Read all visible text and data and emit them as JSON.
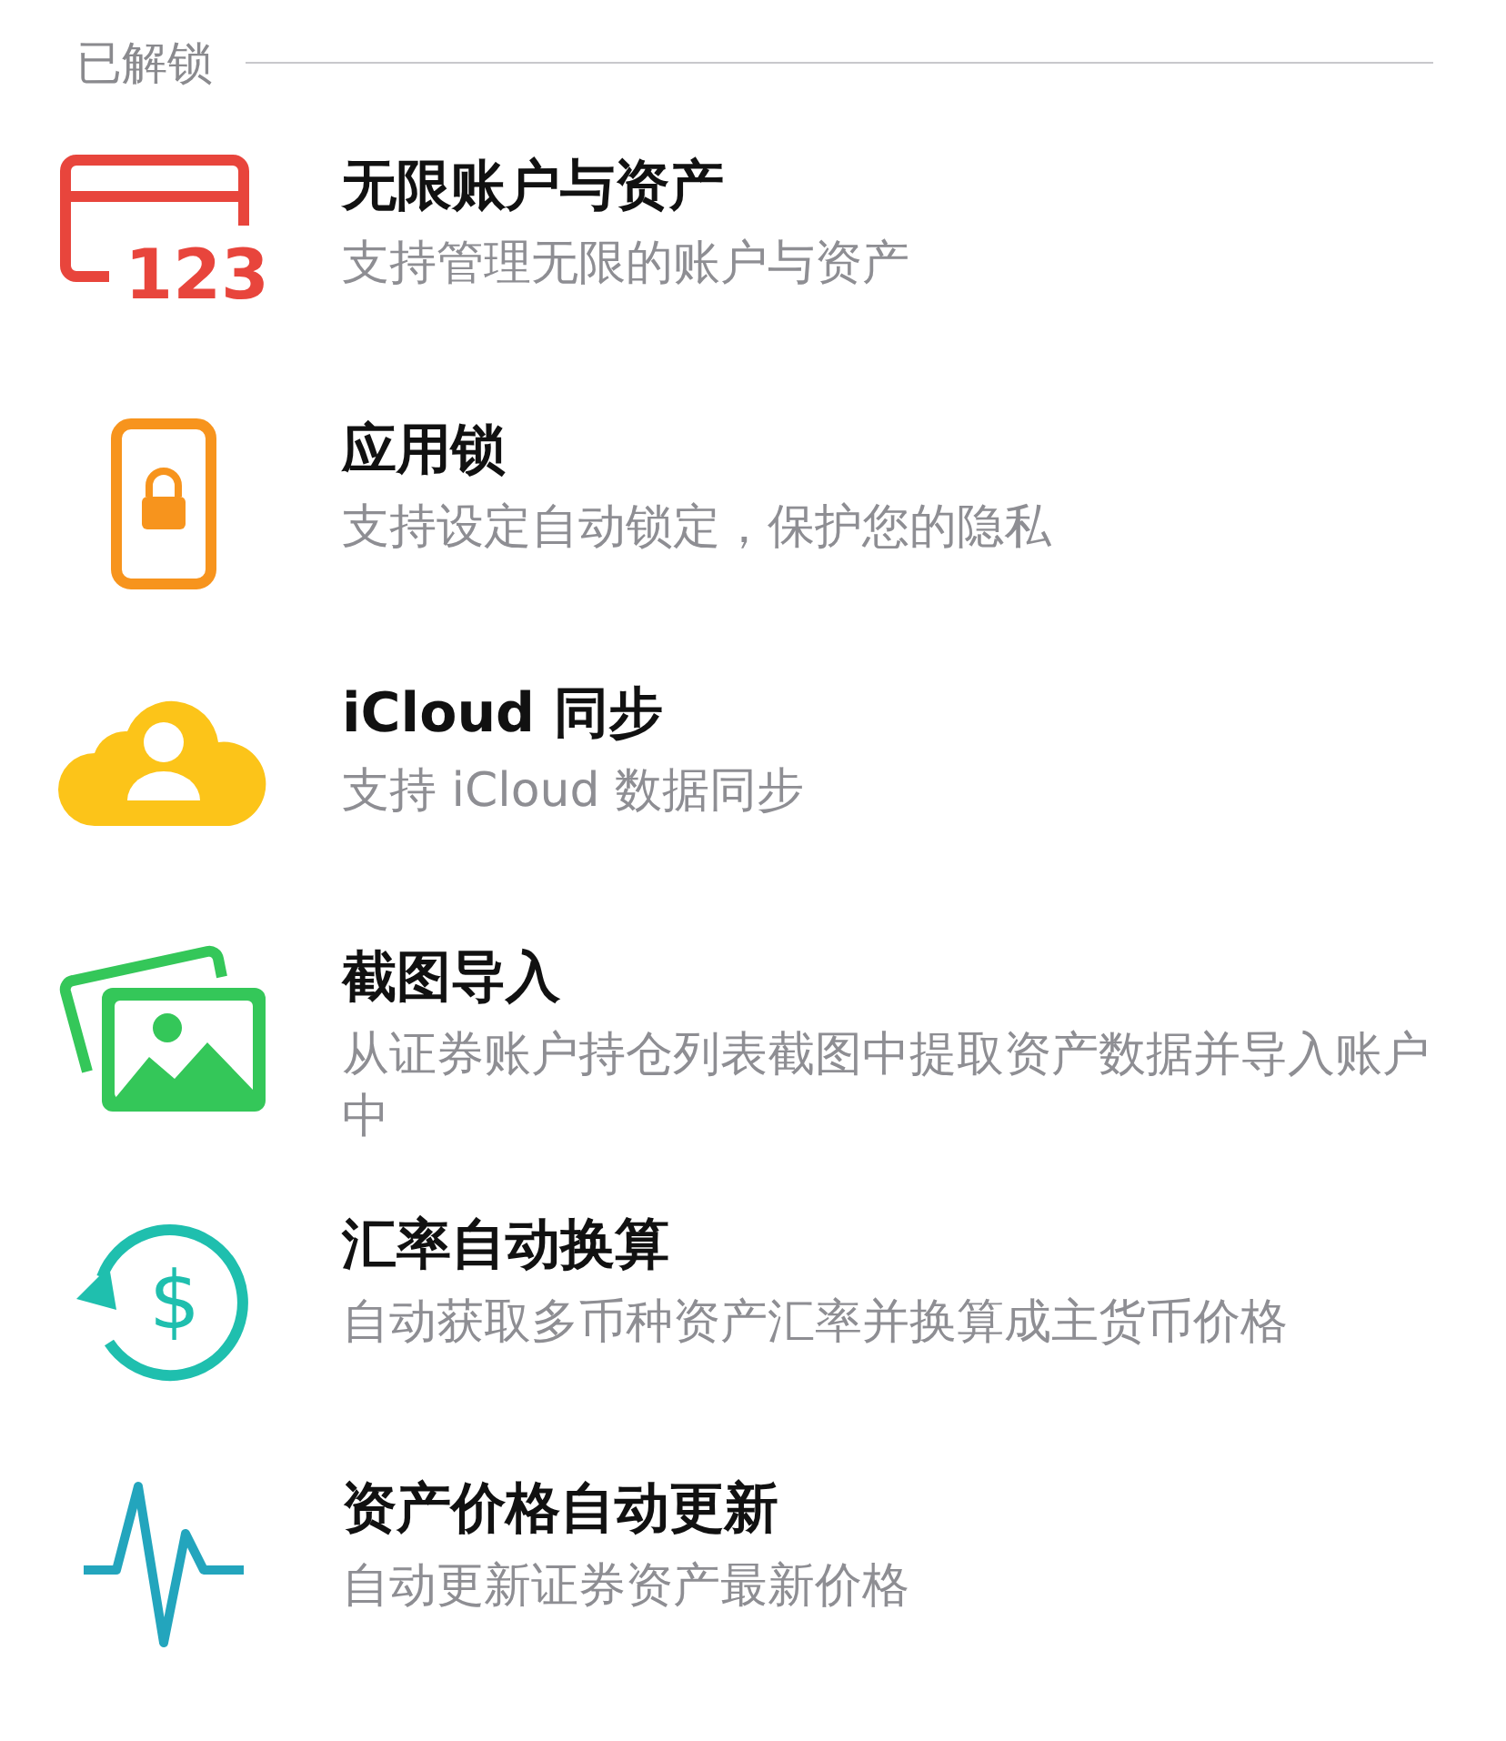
{
  "section": {
    "title": "已解锁"
  },
  "features": [
    {
      "kind": "card",
      "icon_text": "123",
      "title": "无限账户与资产",
      "subtitle": "支持管理无限的账户与资产"
    },
    {
      "kind": "phone-lock",
      "title": "应用锁",
      "subtitle": "支持设定自动锁定，保护您的隐私"
    },
    {
      "kind": "cloud-person",
      "title": "iCloud 同步",
      "subtitle": "支持 iCloud 数据同步"
    },
    {
      "kind": "photos",
      "title": "截图导入",
      "subtitle": "从证券账户持仓列表截图中提取资产数据并导入账户中"
    },
    {
      "kind": "currency-refresh",
      "icon_text": "$",
      "title": "汇率自动换算",
      "subtitle": "自动获取多币种资产汇率并换算成主货币价格"
    },
    {
      "kind": "pulse",
      "title": "资产价格自动更新",
      "subtitle": "自动更新证券资产最新价格"
    }
  ]
}
